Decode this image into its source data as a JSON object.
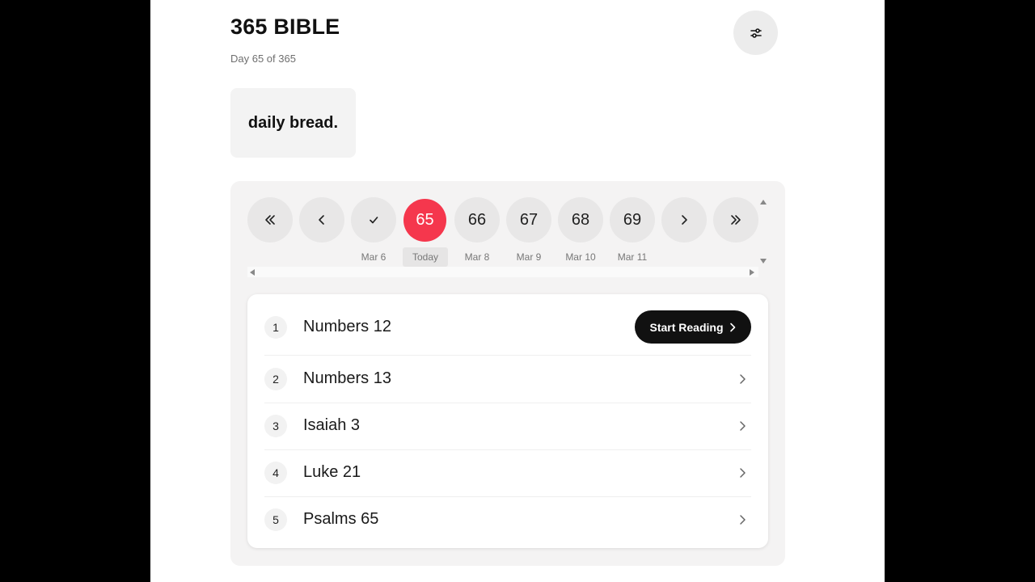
{
  "header": {
    "title": "365 BIBLE",
    "subtitle": "Day 65 of 365",
    "settings_icon": "sliders-icon"
  },
  "brand": {
    "text": "daily bread."
  },
  "colors": {
    "accent": "#f5374d",
    "dark": "#111111",
    "panel": "#f4f3f3"
  },
  "day_strip": {
    "nav_first_icon": "double-chevron-left-icon",
    "nav_prev_icon": "chevron-left-icon",
    "nav_next_icon": "chevron-right-icon",
    "nav_last_icon": "double-chevron-right-icon",
    "days": [
      {
        "label": "",
        "date": "Mar 6",
        "status": "completed",
        "icon": "check-icon"
      },
      {
        "label": "65",
        "date": "Today",
        "status": "active"
      },
      {
        "label": "66",
        "date": "Mar 8",
        "status": "upcoming"
      },
      {
        "label": "67",
        "date": "Mar 9",
        "status": "upcoming"
      },
      {
        "label": "68",
        "date": "Mar 10",
        "status": "upcoming"
      },
      {
        "label": "69",
        "date": "Mar 11",
        "status": "upcoming"
      }
    ]
  },
  "readings": [
    {
      "num": "1",
      "name": "Numbers 12",
      "action": "Start Reading"
    },
    {
      "num": "2",
      "name": "Numbers 13"
    },
    {
      "num": "3",
      "name": "Isaiah 3"
    },
    {
      "num": "4",
      "name": "Luke 21"
    },
    {
      "num": "5",
      "name": "Psalms 65"
    }
  ]
}
